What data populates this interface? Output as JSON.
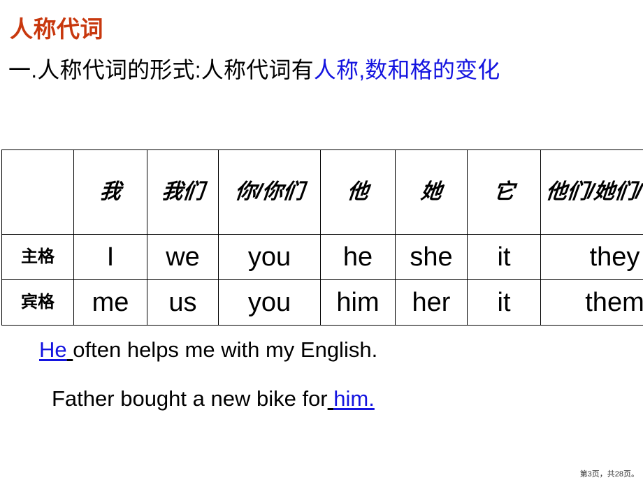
{
  "slide": {
    "title": "人称代词",
    "subtitle": {
      "lead": "一.人称代词的形式:人称代词有",
      "highlight": "人称,数和格的变化"
    }
  },
  "table": {
    "headers": [
      "",
      "我",
      "我们",
      "你/你们",
      "他",
      "她",
      "它",
      "他们/她们/它们"
    ],
    "rows": [
      {
        "label": "主格",
        "cells": [
          "I",
          "we",
          "you",
          "he",
          "she",
          "it",
          "they"
        ]
      },
      {
        "label": "宾格",
        "cells": [
          "me",
          "us",
          "you",
          "him",
          "her",
          "it",
          "them"
        ]
      }
    ]
  },
  "examples": [
    {
      "highlight": "He",
      "gap": " ",
      "rest": "often helps me with my English.",
      "prefix": ""
    },
    {
      "prefix": "Father bought a new bike for",
      "gap": " ",
      "highlight": "him.",
      "rest": ""
    }
  ],
  "footer": {
    "text": "第3页，共28页。"
  },
  "colors": {
    "title_red": "#c8380e",
    "highlight_blue": "#1414e0",
    "text_black": "#000000",
    "background": "#ffffff"
  }
}
